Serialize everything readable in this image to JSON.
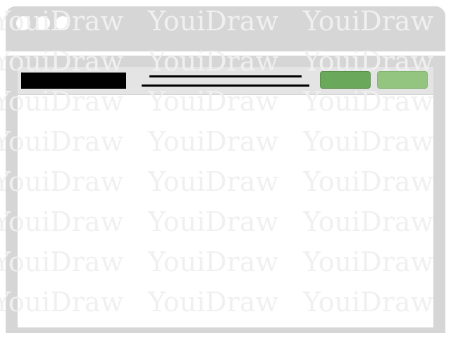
{
  "window": {
    "title_dots": [
      "close-dot",
      "minimize-dot",
      "maximize-dot"
    ]
  },
  "watermark": {
    "text": "YouiDraw"
  },
  "navbar": {
    "logo_color": "#000000",
    "primary_button_color": "#6aa85b",
    "secondary_button_color": "#93c580"
  },
  "colors": {
    "chrome": "#d6d6d6",
    "navbar_bg": "#e4e4e4",
    "content_bg": "#ffffff"
  }
}
